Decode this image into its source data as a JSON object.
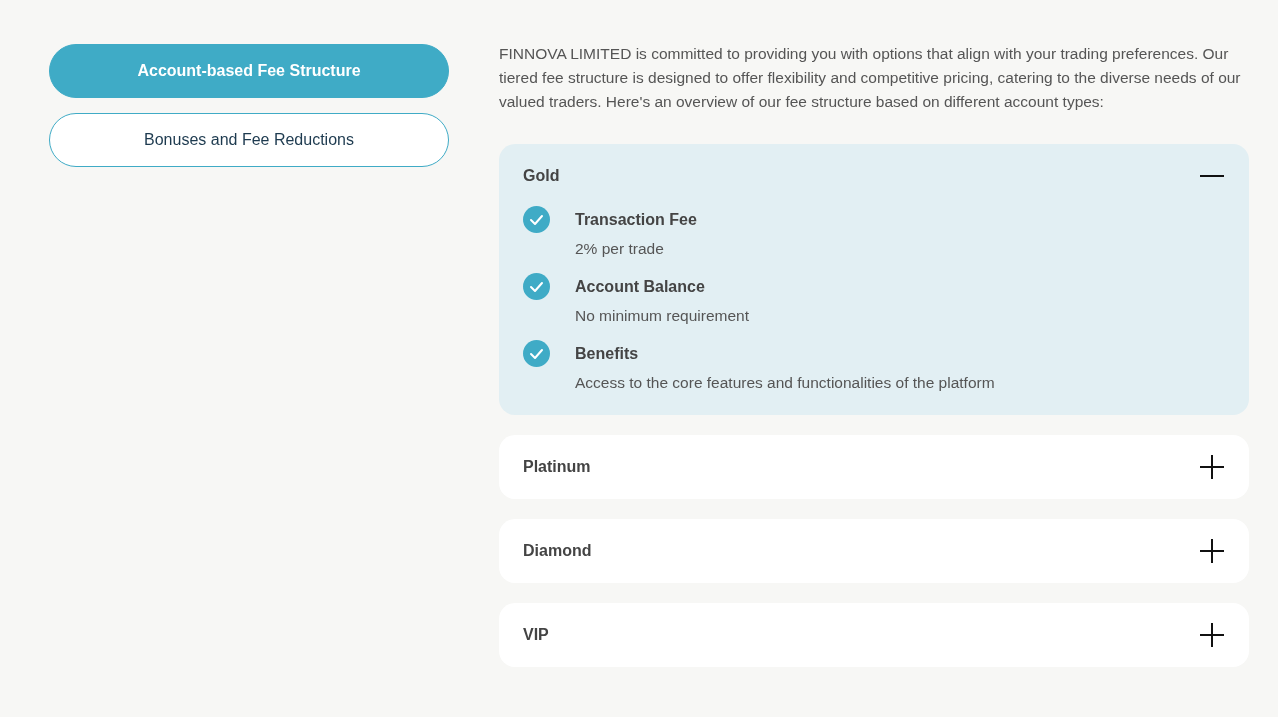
{
  "tabs": [
    {
      "label": "Account-based Fee Structure",
      "selected": true
    },
    {
      "label": "Bonuses and Fee Reductions",
      "selected": false
    }
  ],
  "intro": "FINNOVA LIMITED is committed to providing you with options that align with your trading preferences. Our tiered fee structure is designed to offer flexibility and competitive pricing, catering to the diverse needs of our valued traders. Here's an overview of our fee structure based on different account types:",
  "accounts": [
    {
      "title": "Gold",
      "expanded": true,
      "features": [
        {
          "label": "Transaction Fee",
          "value": "2% per trade"
        },
        {
          "label": "Account Balance",
          "value": "No minimum requirement"
        },
        {
          "label": "Benefits",
          "value": "Access to the core features and functionalities of the platform"
        }
      ]
    },
    {
      "title": "Platinum",
      "expanded": false
    },
    {
      "title": "Diamond",
      "expanded": false
    },
    {
      "title": "VIP",
      "expanded": false
    }
  ]
}
